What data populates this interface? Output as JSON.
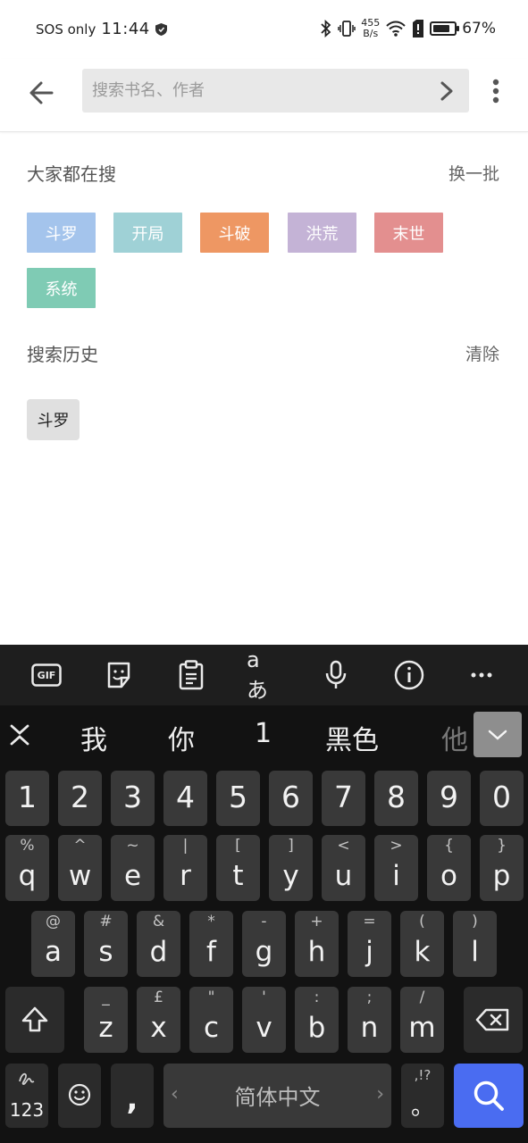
{
  "status_bar": {
    "carrier": "SOS only",
    "time": "11:44",
    "net_speed_value": "455",
    "net_speed_unit": "B/s",
    "battery": "67%",
    "battery_level": 0.67
  },
  "topbar": {
    "search_placeholder": "搜索书名、作者",
    "search_value": ""
  },
  "trending": {
    "title": "大家都在搜",
    "action": "换一批",
    "tags": [
      {
        "label": "斗罗",
        "color": "#a4c4ec"
      },
      {
        "label": "开局",
        "color": "#9fd1d6"
      },
      {
        "label": "斗破",
        "color": "#ee9763"
      },
      {
        "label": "洪荒",
        "color": "#c4b3d6"
      },
      {
        "label": "末世",
        "color": "#e38f8f"
      },
      {
        "label": "系统",
        "color": "#7fcbb4"
      }
    ]
  },
  "history": {
    "title": "搜索历史",
    "action": "清除",
    "items": [
      "斗罗"
    ]
  },
  "keyboard": {
    "toolbar_icons": [
      "gif-icon",
      "sticker-icon",
      "clipboard-icon",
      "translate-icon",
      "microphone-icon",
      "info-icon",
      "more-icon"
    ],
    "translate_label": "aあ",
    "gif_label": "GIF",
    "suggestions": [
      "我",
      "你",
      "1",
      "黑色",
      "他"
    ],
    "number_row": [
      "1",
      "2",
      "3",
      "4",
      "5",
      "6",
      "7",
      "8",
      "9",
      "0"
    ],
    "row1": [
      {
        "main": "q",
        "sub": "%"
      },
      {
        "main": "w",
        "sub": "^"
      },
      {
        "main": "e",
        "sub": "~"
      },
      {
        "main": "r",
        "sub": "|"
      },
      {
        "main": "t",
        "sub": "["
      },
      {
        "main": "y",
        "sub": "]"
      },
      {
        "main": "u",
        "sub": "<"
      },
      {
        "main": "i",
        "sub": ">"
      },
      {
        "main": "o",
        "sub": "{"
      },
      {
        "main": "p",
        "sub": "}"
      }
    ],
    "row2": [
      {
        "main": "a",
        "sub": "@"
      },
      {
        "main": "s",
        "sub": "#"
      },
      {
        "main": "d",
        "sub": "&"
      },
      {
        "main": "f",
        "sub": "*"
      },
      {
        "main": "g",
        "sub": "-"
      },
      {
        "main": "h",
        "sub": "+"
      },
      {
        "main": "j",
        "sub": "="
      },
      {
        "main": "k",
        "sub": "("
      },
      {
        "main": "l",
        "sub": ")"
      }
    ],
    "row3": [
      {
        "main": "z",
        "sub": "_"
      },
      {
        "main": "x",
        "sub": "£"
      },
      {
        "main": "c",
        "sub": "\""
      },
      {
        "main": "v",
        "sub": "'"
      },
      {
        "main": "b",
        "sub": ":"
      },
      {
        "main": "n",
        "sub": ";"
      },
      {
        "main": "m",
        "sub": "/"
      }
    ],
    "symbols_label": "123",
    "comma": ",",
    "space_label": "简体中文",
    "period_main": "。",
    "period_sub": ",!?"
  }
}
